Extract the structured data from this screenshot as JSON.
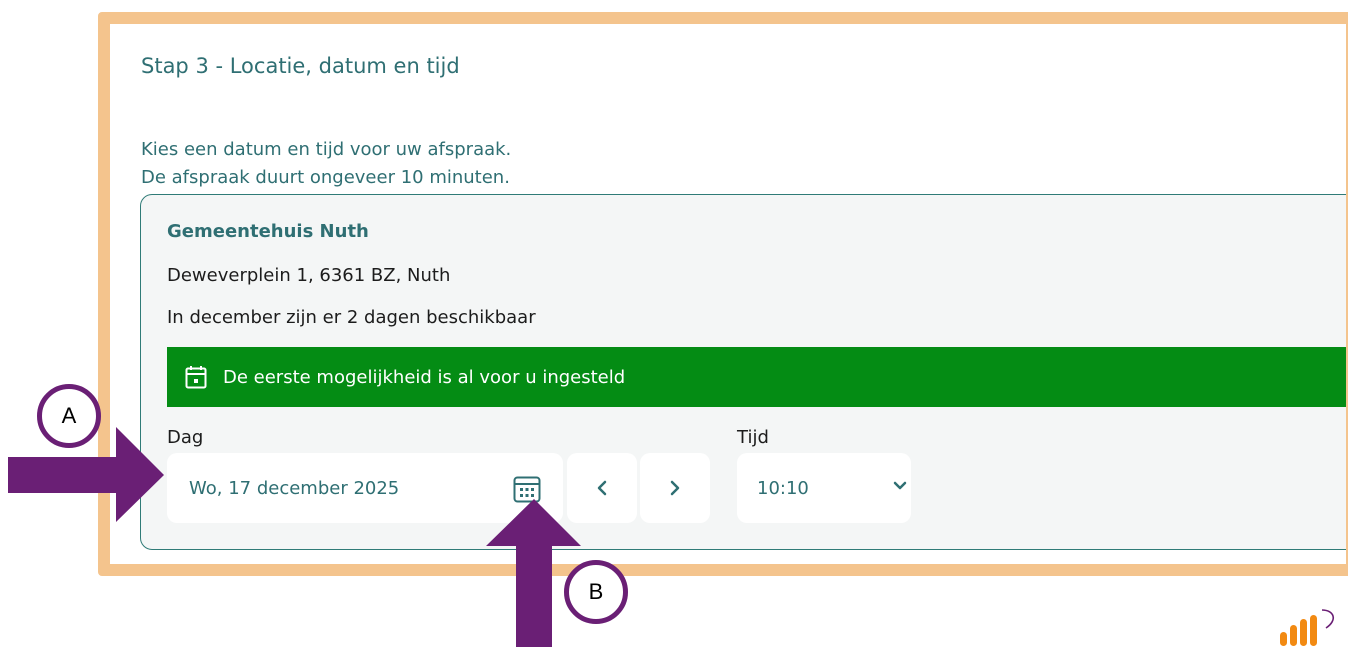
{
  "step": {
    "title": "Stap 3 - Locatie, datum en tijd"
  },
  "intro": {
    "line1": "Kies een datum en tijd voor uw afspraak.",
    "line2": "De afspraak duurt ongeveer 10 minuten."
  },
  "location": {
    "name": "Gemeentehuis Nuth",
    "address": "Deweverplein 1, 6361 BZ, Nuth",
    "availability": "In december zijn er 2 dagen beschikbaar"
  },
  "notice": {
    "text": "De eerste mogelijkheid is al voor u ingesteld",
    "icon": "calendar-icon"
  },
  "fields": {
    "day_label": "Dag",
    "day_value": "Wo, 17 december 2025",
    "time_label": "Tijd",
    "time_value": "10:10"
  },
  "annotations": {
    "marker_a": "A",
    "marker_b": "B"
  },
  "colors": {
    "frame_border": "#f4c48d",
    "teal_text": "#2f6f73",
    "notice_green": "#048c14",
    "arrow_purple": "#6a1f75",
    "logo_orange": "#f28a12"
  }
}
